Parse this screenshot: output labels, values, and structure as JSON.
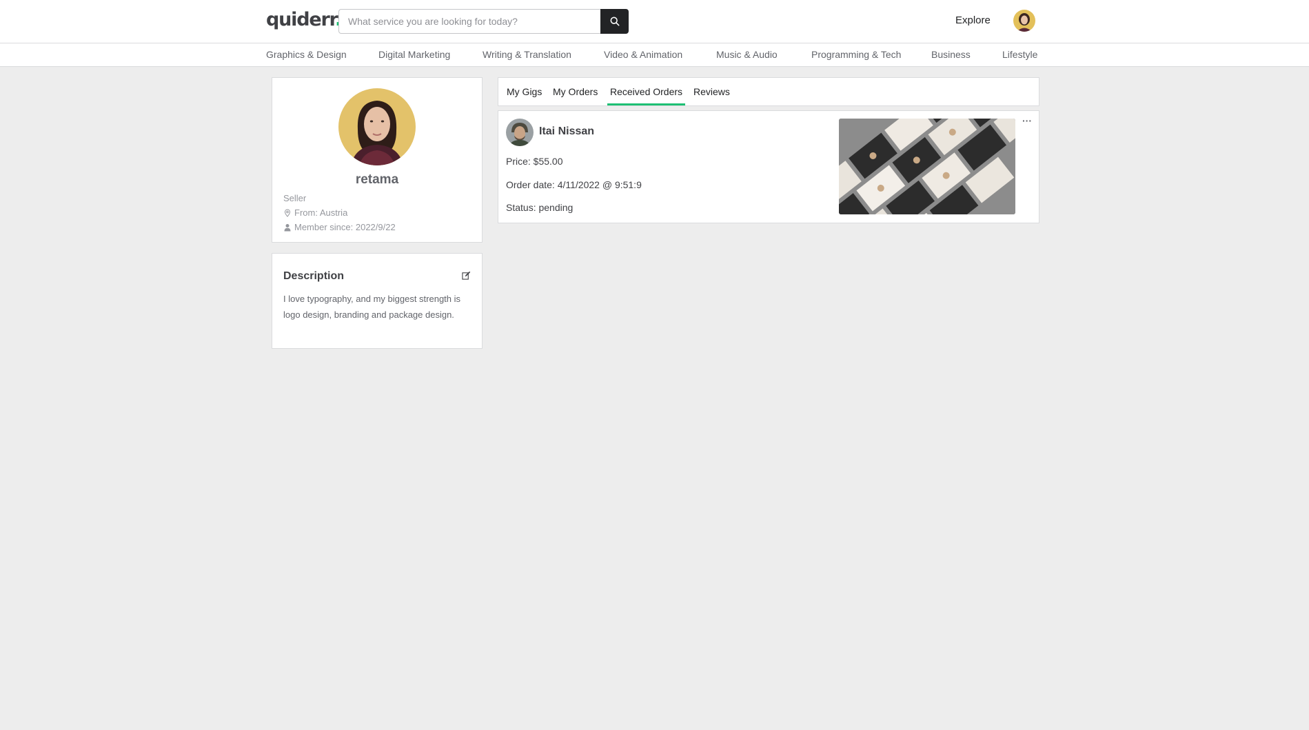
{
  "header": {
    "logo_text": "quiderr",
    "logo_dot": ".",
    "search_placeholder": "What service you are looking for today?",
    "explore_label": "Explore"
  },
  "categories": [
    "Graphics & Design",
    "Digital Marketing",
    "Writing & Translation",
    "Video & Animation",
    "Music & Audio",
    "Programming & Tech",
    "Business",
    "Lifestyle"
  ],
  "profile": {
    "username": "retama",
    "role": "Seller",
    "from": "From: Austria",
    "member_since": "Member since: 2022/9/22"
  },
  "description": {
    "title": "Description",
    "text": "I love typography, and my biggest strength is logo design, branding and package design."
  },
  "tabs": [
    {
      "label": "My Gigs",
      "active": false
    },
    {
      "label": "My Orders",
      "active": false
    },
    {
      "label": "Received Orders",
      "active": true
    },
    {
      "label": "Reviews",
      "active": false
    }
  ],
  "order": {
    "buyer_name": "Itai Nissan",
    "price": "Price: $55.00",
    "order_date": "Order date: 4/11/2022 @ 9:51:9",
    "status": "Status: pending",
    "more_label": "···"
  },
  "colors": {
    "accent": "#1dbf73",
    "background": "#ededed",
    "search_button": "#222325"
  }
}
